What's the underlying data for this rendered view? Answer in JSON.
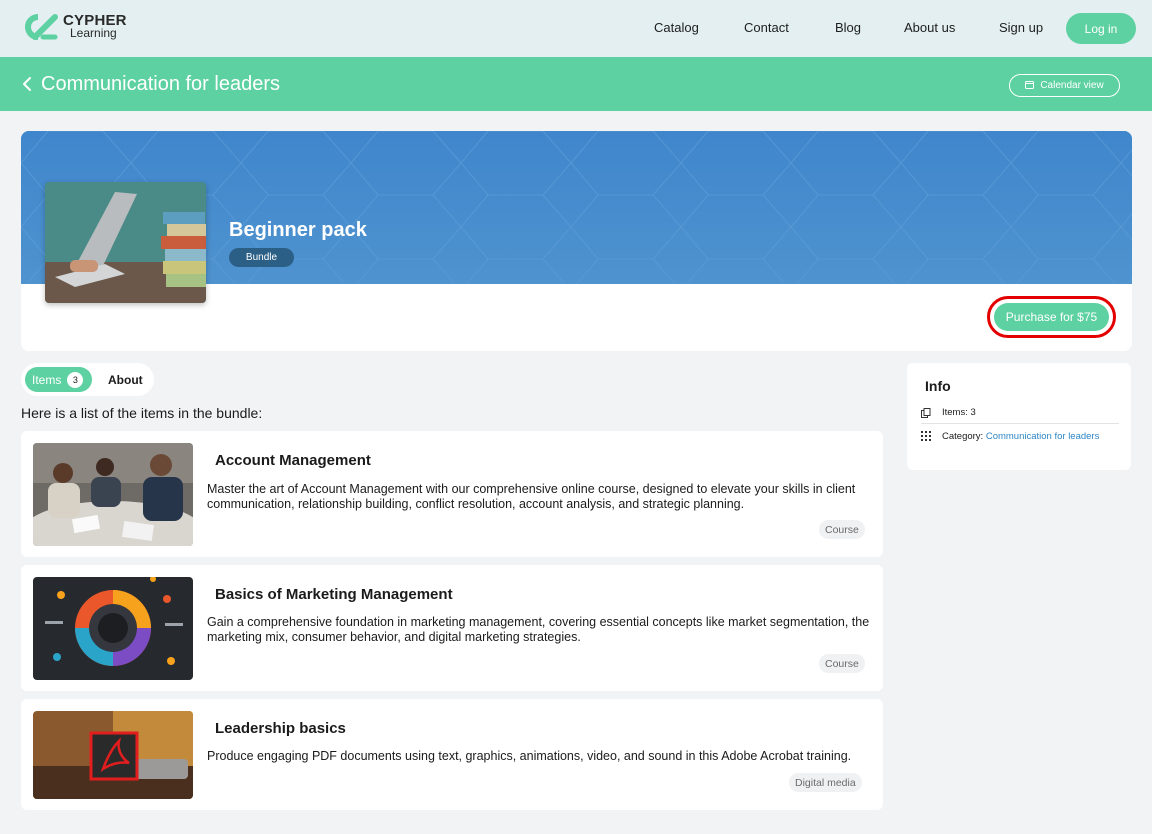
{
  "brand": {
    "line1": "CYPHER",
    "line2": "Learning"
  },
  "nav": {
    "items": [
      "Catalog",
      "Contact",
      "Blog",
      "About us",
      "Sign up"
    ],
    "login": "Log in"
  },
  "header": {
    "title": "Communication for leaders",
    "calendar_view": "Calendar view"
  },
  "hero": {
    "title": "Beginner pack",
    "tag": "Bundle",
    "purchase_label": "Purchase for $75"
  },
  "tabs": {
    "items_label": "Items",
    "items_count": "3",
    "about_label": "About"
  },
  "list_intro": "Here is a list of the items in the bundle:",
  "items": [
    {
      "title": "Account Management",
      "description": "Master the art of Account Management with our comprehensive online course, designed to elevate your skills in client communication, relationship building, conflict resolution, account analysis, and strategic planning.",
      "type": "Course"
    },
    {
      "title": "Basics of Marketing Management",
      "description": "Gain a comprehensive foundation in marketing management, covering essential concepts like market segmentation, the marketing mix, consumer behavior, and digital marketing strategies.",
      "type": "Course"
    },
    {
      "title": "Leadership basics",
      "description": "Produce engaging PDF documents using text, graphics, animations, video, and sound in this Adobe Acrobat training.",
      "type": "Digital media"
    }
  ],
  "info": {
    "title": "Info",
    "items_text": "Items: 3",
    "category_label": "Category:",
    "category_value": "Communication for leaders"
  },
  "colors": {
    "accent": "#5dd1a1",
    "banner": "#4a8dcc",
    "highlight": "#e30000",
    "link": "#2f86c6"
  }
}
